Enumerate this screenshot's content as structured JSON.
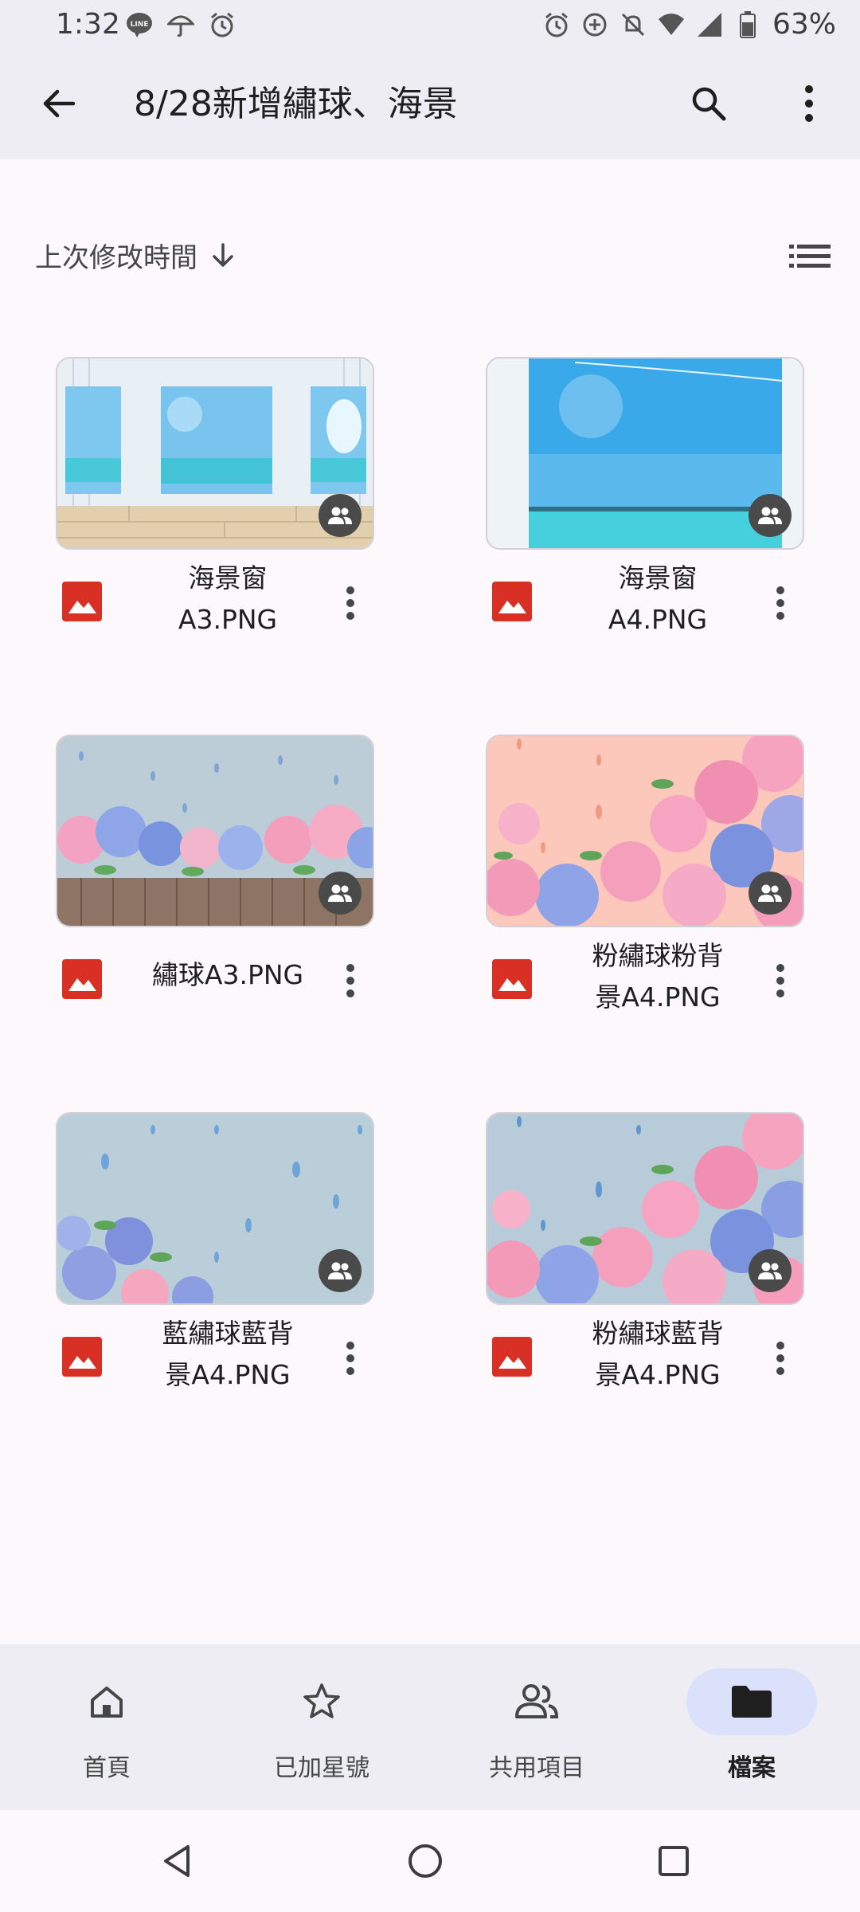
{
  "status_bar": {
    "time": "1:32",
    "battery": "63%",
    "left_icons": [
      "line-icon",
      "umbrella-icon",
      "alarm-icon"
    ],
    "right_icons": [
      "alarm-icon",
      "data-saver-icon",
      "silent-icon",
      "wifi-icon",
      "signal-icon",
      "battery-icon"
    ]
  },
  "app_bar": {
    "title": "8/28新增繡球、海景",
    "icons": [
      "back-arrow-icon",
      "search-icon",
      "more-vert-icon"
    ]
  },
  "sort": {
    "label": "上次修改時間",
    "direction_icon": "arrow-down-icon",
    "view_icon": "list-view-icon"
  },
  "files": [
    {
      "name_line1": "海景窗",
      "name_line2": "A3.PNG",
      "type_icon": "image-file-icon",
      "shared": true,
      "thumb": "sea-window-a3"
    },
    {
      "name_line1": "海景窗",
      "name_line2": "A4.PNG",
      "type_icon": "image-file-icon",
      "shared": true,
      "thumb": "sea-window-a4"
    },
    {
      "name_line1": "繡球A3.PNG",
      "name_line2": "",
      "type_icon": "image-file-icon",
      "shared": true,
      "thumb": "hydrangea-a3"
    },
    {
      "name_line1": "粉繡球粉背",
      "name_line2": "景A4.PNG",
      "type_icon": "image-file-icon",
      "shared": true,
      "thumb": "pink-hydrangea-pink-bg"
    },
    {
      "name_line1": "藍繡球藍背",
      "name_line2": "景A4.PNG",
      "type_icon": "image-file-icon",
      "shared": true,
      "thumb": "blue-hydrangea-blue-bg"
    },
    {
      "name_line1": "粉繡球藍背",
      "name_line2": "景A4.PNG",
      "type_icon": "image-file-icon",
      "shared": true,
      "thumb": "pink-hydrangea-blue-bg"
    }
  ],
  "bottom_nav": {
    "items": [
      {
        "label": "首頁",
        "icon": "home-icon",
        "active": false
      },
      {
        "label": "已加星號",
        "icon": "star-icon",
        "active": false
      },
      {
        "label": "共用項目",
        "icon": "people-icon",
        "active": false
      },
      {
        "label": "檔案",
        "icon": "folder-icon",
        "active": true
      }
    ]
  },
  "system_nav": {
    "icons": [
      "back-triangle-icon",
      "home-circle-icon",
      "recents-square-icon"
    ]
  },
  "colors": {
    "app_bar_bg": "#eeedf3",
    "page_bg": "#fcf8fc",
    "active_pill": "#dbe1fa",
    "file_icon_red": "#d93025",
    "shared_badge": "#4a4a4a"
  }
}
